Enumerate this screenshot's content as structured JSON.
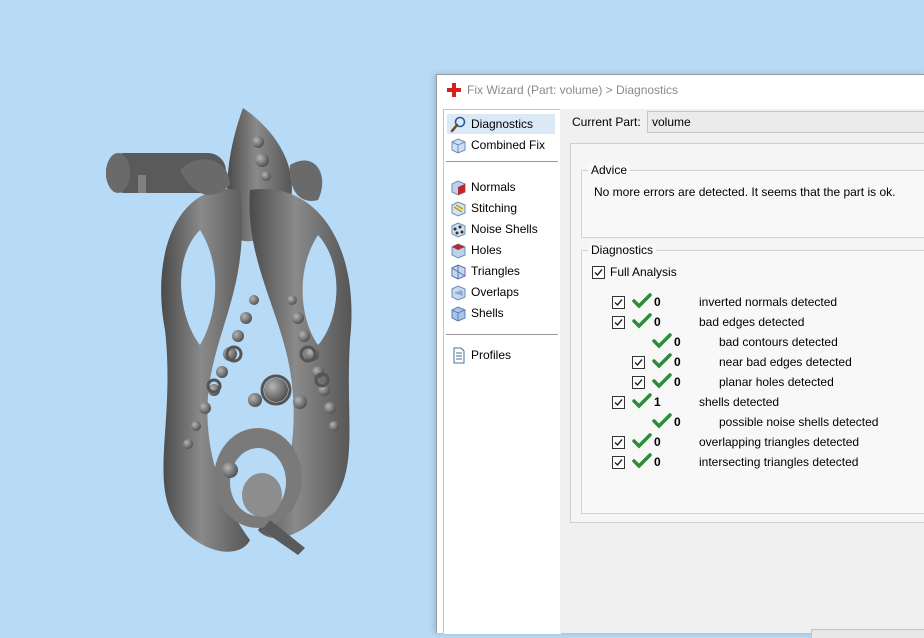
{
  "window": {
    "title": "Fix Wizard (Part: volume) > Diagnostics"
  },
  "sidebar": {
    "items": [
      {
        "label": "Diagnostics",
        "icon": "magnifier-icon"
      },
      {
        "label": "Combined Fix",
        "icon": "cube-icon"
      },
      {
        "label": "Normals",
        "icon": "normals-icon"
      },
      {
        "label": "Stitching",
        "icon": "stitching-icon"
      },
      {
        "label": "Noise Shells",
        "icon": "noise-shells-icon"
      },
      {
        "label": "Holes",
        "icon": "holes-icon"
      },
      {
        "label": "Triangles",
        "icon": "triangles-icon"
      },
      {
        "label": "Overlaps",
        "icon": "overlaps-icon"
      },
      {
        "label": "Shells",
        "icon": "shells-icon"
      },
      {
        "label": "Profiles",
        "icon": "document-icon"
      }
    ],
    "selected": "Diagnostics"
  },
  "current_part": {
    "label": "Current Part:",
    "value": "volume"
  },
  "advice": {
    "title": "Advice",
    "text": "No more errors are detected. It seems that the part is ok."
  },
  "diagnostics": {
    "title": "Diagnostics",
    "full_analysis": {
      "label": "Full Analysis",
      "checked": true
    },
    "rows": [
      {
        "count": "0",
        "label": "inverted normals detected",
        "checkbox": true,
        "indent": 0
      },
      {
        "count": "0",
        "label": "bad edges detected",
        "checkbox": true,
        "indent": 0
      },
      {
        "count": "0",
        "label": "bad contours detected",
        "checkbox": false,
        "indent": 1
      },
      {
        "count": "0",
        "label": "near bad edges detected",
        "checkbox": true,
        "indent": 1
      },
      {
        "count": "0",
        "label": "planar holes detected",
        "checkbox": true,
        "indent": 1
      },
      {
        "count": "1",
        "label": "shells detected",
        "checkbox": true,
        "indent": 0
      },
      {
        "count": "0",
        "label": "possible noise shells detected",
        "checkbox": false,
        "indent": 1
      },
      {
        "count": "0",
        "label": "overlapping triangles detected",
        "checkbox": true,
        "indent": 0
      },
      {
        "count": "0",
        "label": "intersecting triangles detected",
        "checkbox": true,
        "indent": 0
      }
    ]
  },
  "colors": {
    "viewport_bg": "#b7daf6",
    "model": "#6e6e6e",
    "check_green": "#2e8b3a",
    "selection": "#dbe8f6"
  }
}
